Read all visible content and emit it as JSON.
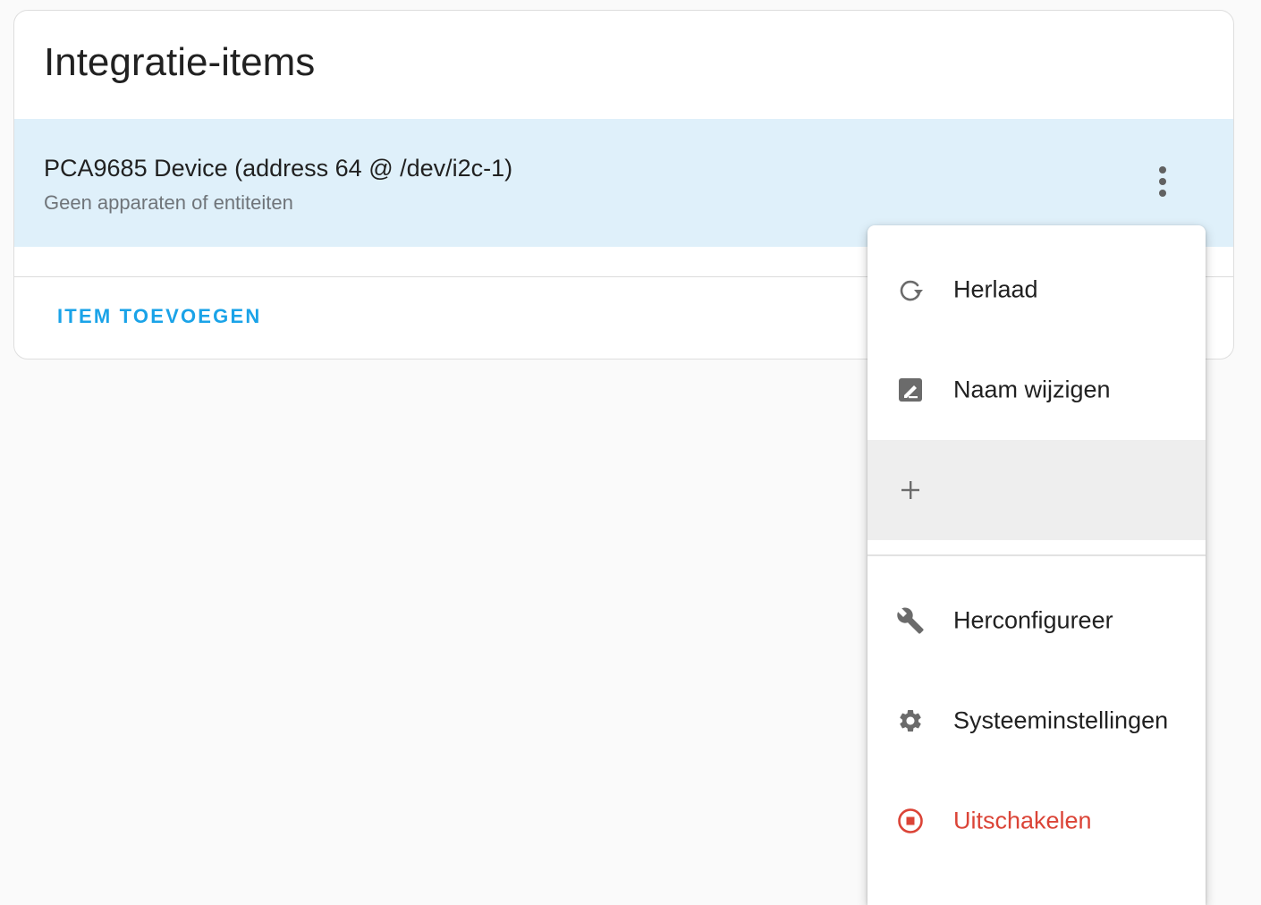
{
  "card": {
    "title": "Integratie-items",
    "entry": {
      "name": "PCA9685 Device (address 64 @ /dev/i2c-1)",
      "subtitle": "Geen apparaten of entiteiten"
    },
    "add_button": "ITEM TOEVOEGEN"
  },
  "menu": {
    "items": [
      {
        "label": "Herlaad",
        "icon": "reload-icon"
      },
      {
        "label": "Naam wijzigen",
        "icon": "rename-icon"
      },
      {
        "label": "",
        "icon": "plus-icon"
      },
      {
        "label": "Herconfigureer",
        "icon": "wrench-icon"
      },
      {
        "label": "Systeeminstellingen",
        "icon": "gear-icon"
      },
      {
        "label": "Uitschakelen",
        "icon": "stop-circle-icon"
      }
    ]
  },
  "colors": {
    "accent": "#1aa3e8",
    "selected_row": "#dff0fa",
    "danger": "#db4437",
    "icon": "#6b6b6b"
  }
}
